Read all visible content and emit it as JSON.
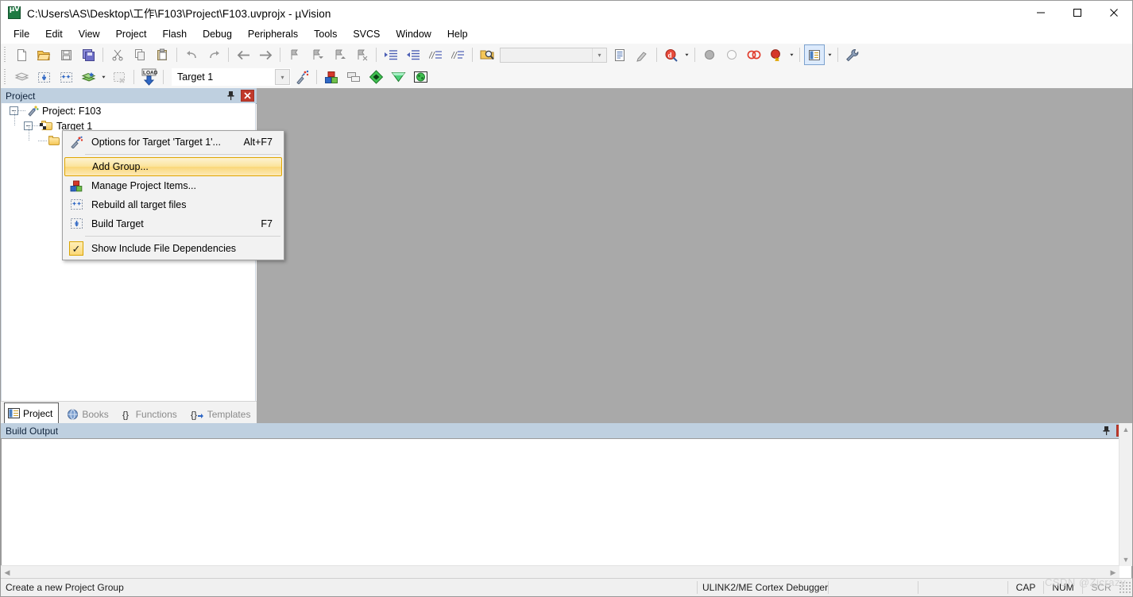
{
  "window": {
    "title": "C:\\Users\\AS\\Desktop\\工作\\F103\\Project\\F103.uvprojx - µVision",
    "app_icon": "uvision-logo-icon",
    "controls": {
      "minimize": "minimize-icon",
      "maximize": "maximize-icon",
      "close": "close-icon"
    }
  },
  "menubar": {
    "items": [
      {
        "label": "File"
      },
      {
        "label": "Edit"
      },
      {
        "label": "View"
      },
      {
        "label": "Project"
      },
      {
        "label": "Flash"
      },
      {
        "label": "Debug"
      },
      {
        "label": "Peripherals"
      },
      {
        "label": "Tools"
      },
      {
        "label": "SVCS"
      },
      {
        "label": "Window"
      },
      {
        "label": "Help"
      }
    ]
  },
  "toolbar_file": {
    "buttons": [
      {
        "name": "new-file-icon",
        "glyph": "\u0001"
      },
      {
        "name": "open-file-icon",
        "glyph": "\u0001"
      },
      {
        "name": "save-icon",
        "glyph": "\u0001"
      },
      {
        "name": "save-all-icon",
        "glyph": "\u0001"
      },
      {
        "name": "cut-icon",
        "glyph": "✂"
      },
      {
        "name": "copy-icon",
        "glyph": "\u0001"
      },
      {
        "name": "paste-icon",
        "glyph": "\u0001"
      },
      {
        "name": "undo-icon",
        "glyph": "↶"
      },
      {
        "name": "redo-icon",
        "glyph": "↷"
      },
      {
        "name": "navigate-back-icon",
        "glyph": "←"
      },
      {
        "name": "navigate-forward-icon",
        "glyph": "→"
      },
      {
        "name": "bookmark-toggle-icon",
        "glyph": "⚑"
      },
      {
        "name": "bookmark-prev-icon",
        "glyph": "⚑"
      },
      {
        "name": "bookmark-next-icon",
        "glyph": "⚑"
      },
      {
        "name": "bookmark-clear-icon",
        "glyph": "⚑"
      },
      {
        "name": "indent-icon",
        "glyph": "⇥"
      },
      {
        "name": "outdent-icon",
        "glyph": "⇤"
      },
      {
        "name": "comment-icon",
        "glyph": "//"
      },
      {
        "name": "uncomment-icon",
        "glyph": "//"
      },
      {
        "name": "find-in-files-icon",
        "glyph": "\u0001"
      }
    ],
    "search_box": {
      "value": "",
      "placeholder": ""
    },
    "after_search": [
      {
        "name": "find-next-icon"
      },
      {
        "name": "insert-template-icon"
      },
      {
        "name": "debug-query-icon"
      },
      {
        "name": "breakpoint-set-icon"
      },
      {
        "name": "breakpoint-clear-icon"
      },
      {
        "name": "breakpoint-disable-icon"
      },
      {
        "name": "breakpoint-kill-all-icon"
      },
      {
        "name": "window-layout-icon"
      },
      {
        "name": "configure-icon"
      }
    ]
  },
  "toolbar_build": {
    "buttons": [
      {
        "name": "translate-icon"
      },
      {
        "name": "build-icon"
      },
      {
        "name": "rebuild-all-icon"
      },
      {
        "name": "batch-build-icon"
      },
      {
        "name": "stop-build-icon"
      },
      {
        "name": "download-to-flash-icon",
        "glyph": "LOAD"
      }
    ],
    "target_select": {
      "value": "Target 1"
    },
    "after_target": [
      {
        "name": "options-for-target-icon"
      },
      {
        "name": "manage-project-items-icon"
      },
      {
        "name": "manage-multi-project-icon"
      },
      {
        "name": "pack-installer-icon"
      },
      {
        "name": "manage-run-time-env-icon"
      },
      {
        "name": "software-packs-icon"
      }
    ]
  },
  "project_panel": {
    "title": "Project",
    "pin_icon": "pin-icon",
    "close_icon": "close-icon",
    "tree": [
      {
        "label": "Project: F103",
        "icon": "project-icon",
        "expander": "−",
        "depth": 0
      },
      {
        "label": "Target 1",
        "icon": "target-folder-icon",
        "expander": "−",
        "depth": 1
      },
      {
        "label": "",
        "icon": "group-folder-icon",
        "expander": "",
        "depth": 2
      }
    ],
    "tabs": [
      {
        "label": "Project",
        "icon": "project-tab-icon",
        "active": true
      },
      {
        "label": "Books",
        "icon": "books-tab-icon",
        "active": false
      },
      {
        "label": "Functions",
        "icon": "functions-tab-icon",
        "active": false
      },
      {
        "label": "Templates",
        "icon": "templates-tab-icon",
        "active": false
      }
    ]
  },
  "context_menu": {
    "items": [
      {
        "label": "Options for Target 'Target 1'...",
        "accel": "Alt+F7",
        "icon": "options-for-target-icon",
        "selected": false,
        "separator_after": true
      },
      {
        "label": "Add Group...",
        "accel": "",
        "icon": "",
        "selected": true,
        "separator_after": false
      },
      {
        "label": "Manage Project Items...",
        "accel": "",
        "icon": "manage-project-items-icon",
        "selected": false,
        "separator_after": false
      },
      {
        "label": "Rebuild all target files",
        "accel": "",
        "icon": "rebuild-all-icon",
        "selected": false,
        "separator_after": false
      },
      {
        "label": "Build Target",
        "accel": "F7",
        "icon": "build-target-icon",
        "selected": false,
        "separator_after": true
      },
      {
        "label": "Show Include File Dependencies",
        "accel": "",
        "icon": "checkbox-checked-icon",
        "selected": false,
        "separator_after": false
      }
    ]
  },
  "build_output": {
    "title": "Build Output",
    "pin_icon": "pin-icon",
    "close_icon": "close-icon",
    "content": ""
  },
  "statusbar": {
    "message": "Create a new Project Group",
    "debugger": "ULINK2/ME Cortex Debugger",
    "indicators": [
      {
        "label": "CAP"
      },
      {
        "label": "NUM"
      },
      {
        "label": "SCR"
      }
    ]
  },
  "watermark": {
    "text": "CSDN @Zjcrazy"
  },
  "colors": {
    "panel_title_bg": "#bfd0e0",
    "mdi_bg": "#a9a9a9",
    "menu_highlight": "#fbe39a",
    "menu_highlight_border": "#e0a500",
    "close_button_red": "#c0392b",
    "toolbar_bg": "#f6f6f6",
    "active_tool_bg": "#dceafc"
  }
}
